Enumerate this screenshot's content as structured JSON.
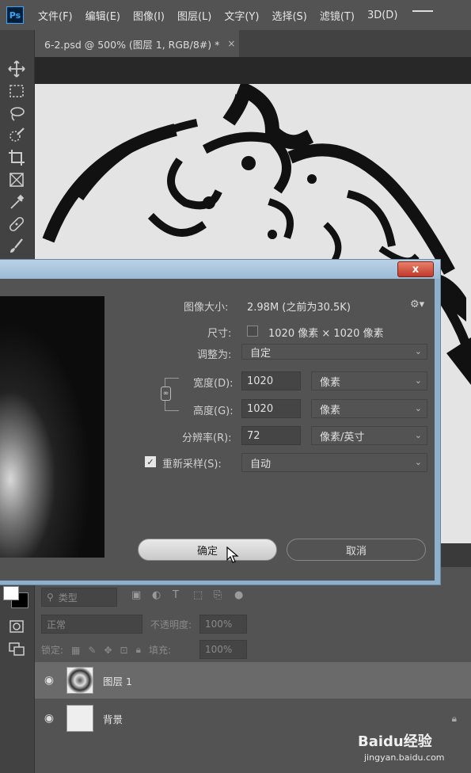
{
  "app": {
    "logo": "Ps"
  },
  "menu": [
    "文件(F)",
    "编辑(E)",
    "图像(I)",
    "图层(L)",
    "文字(Y)",
    "选择(S)",
    "滤镜(T)",
    "3D(D)"
  ],
  "document_tab": {
    "title": "6-2.psd @ 500% (图层 1, RGB/8#) *",
    "close": "×"
  },
  "tools": [
    "move-icon",
    "marquee-icon",
    "lasso-icon",
    "quick-select-icon",
    "crop-icon",
    "frame-icon",
    "eyedropper-icon",
    "healing-brush-icon",
    "brush-icon"
  ],
  "dialog": {
    "close_label": "x",
    "image_size_label": "图像大小:",
    "image_size_value": "2.98M (之前为30.5K)",
    "dimensions_label": "尺寸:",
    "dimensions_value": "1020 像素 × 1020 像素",
    "fit_to_label": "调整为:",
    "fit_to_value": "自定",
    "width_label": "宽度(D):",
    "width_value": "1020",
    "width_unit": "像素",
    "height_label": "高度(G):",
    "height_value": "1020",
    "height_unit": "像素",
    "resolution_label": "分辨率(R):",
    "resolution_value": "72",
    "resolution_unit": "像素/英寸",
    "resample_label": "重新采样(S):",
    "resample_checked": true,
    "resample_value": "自动",
    "ok_label": "确定",
    "cancel_label": "取消"
  },
  "layers_panel": {
    "filter_placeholder": "类型",
    "blend_mode": "正常",
    "opacity_label": "不透明度:",
    "opacity_value": "100%",
    "lock_label": "锁定:",
    "fill_label": "填充:",
    "fill_value": "100%",
    "layers": [
      {
        "name": "图层 1",
        "selected": true
      },
      {
        "name": "背景",
        "selected": false,
        "locked": true
      }
    ]
  },
  "watermark": {
    "brand": "Baidu经验",
    "url": "jingyan.baidu.com"
  }
}
